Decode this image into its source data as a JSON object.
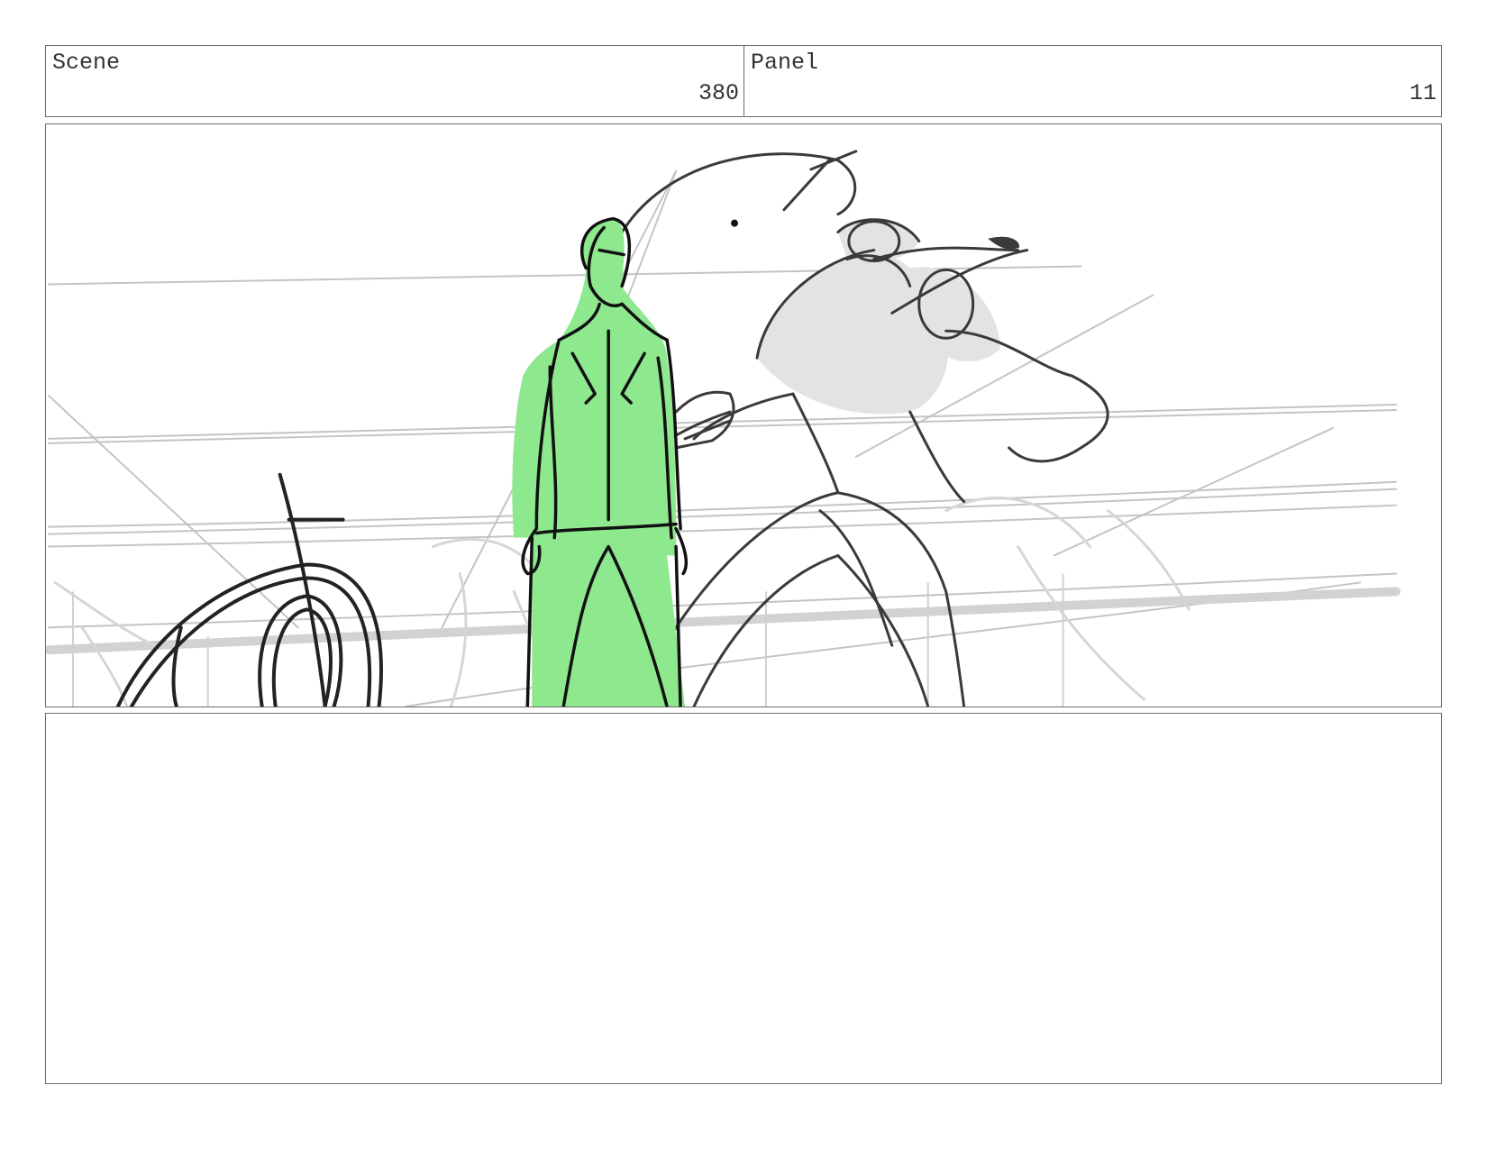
{
  "header": {
    "scene_label": "Scene",
    "scene_number": "380",
    "panel_label": "Panel",
    "panel_number": "11"
  },
  "panel_image": {
    "highlight_color": "#8ee88e",
    "line_color": "#1a1a1a",
    "sketch_gray": "#bdbdbd"
  },
  "notes": {
    "text": ""
  }
}
